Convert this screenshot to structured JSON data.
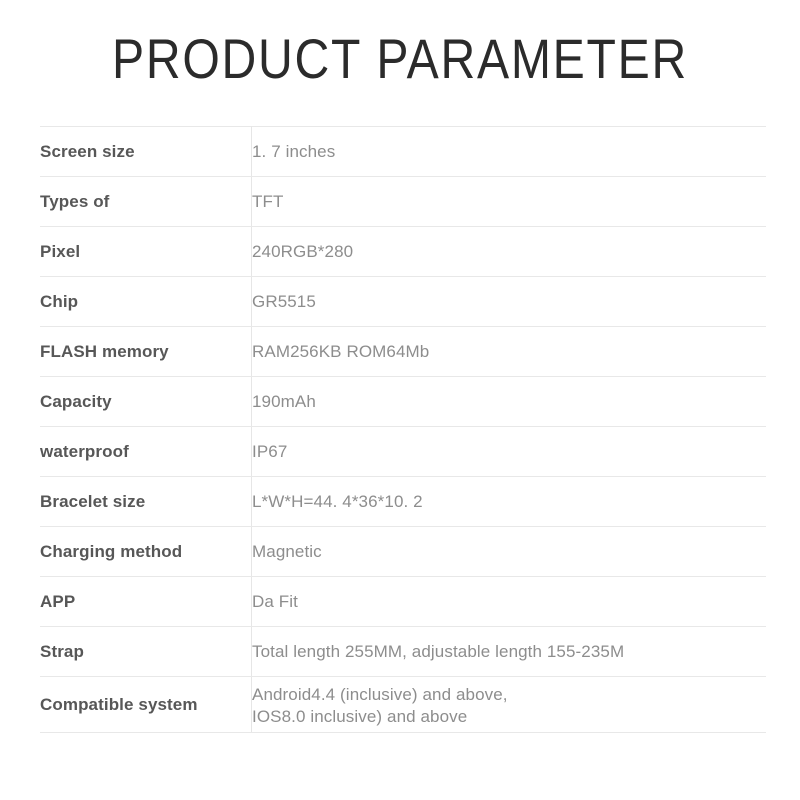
{
  "page": {
    "title": "PRODUCT PARAMETER",
    "accent_color": "#2b2b2b",
    "label_color": "#575757",
    "value_color": "#8d8d8d",
    "rule_color": "#e8e8e8",
    "background_color": "#ffffff"
  },
  "table": {
    "rows": [
      {
        "label": "Screen size",
        "value": "1. 7 inches"
      },
      {
        "label": "Types of",
        "value": "TFT"
      },
      {
        "label": "Pixel",
        "value": "240RGB*280"
      },
      {
        "label": "Chip",
        "value": "GR5515"
      },
      {
        "label": "FLASH memory",
        "value": "RAM256KB ROM64Mb"
      },
      {
        "label": "Capacity",
        "value": "190mAh"
      },
      {
        "label": "waterproof",
        "value": "IP67"
      },
      {
        "label": "Bracelet size",
        "value": "L*W*H=44. 4*36*10. 2"
      },
      {
        "label": "Charging method",
        "value": "Magnetic"
      },
      {
        "label": "APP",
        "value": "Da Fit"
      },
      {
        "label": "Strap",
        "value": "Total length 255MM, adjustable length 155-235M"
      },
      {
        "label": "Compatible system",
        "value_line1": "Android4.4 (inclusive) and above,",
        "value_line2": "IOS8.0 inclusive) and above"
      }
    ]
  }
}
